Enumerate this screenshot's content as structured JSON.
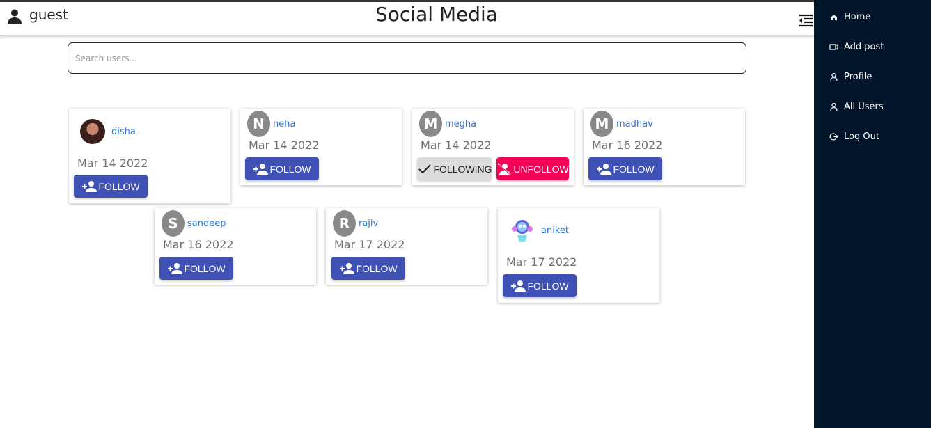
{
  "header": {
    "username": "guest",
    "title": "Social Media",
    "user_icon": "person-icon",
    "menu_icon": "menu-collapse-icon"
  },
  "search": {
    "placeholder": "Search users..."
  },
  "users": [
    {
      "name": "disha",
      "date": "Mar 14 2022",
      "avatar": "photo",
      "buttons": [
        "FOLLOW"
      ]
    },
    {
      "name": "neha",
      "date": "Mar 14 2022",
      "avatar_letter": "N",
      "buttons": [
        "FOLLOW"
      ]
    },
    {
      "name": "megha",
      "date": "Mar 14 2022",
      "avatar_letter": "M",
      "buttons": [
        "FOLLOWING",
        "UNFOLLOW"
      ]
    },
    {
      "name": "madhav",
      "date": "Mar 16 2022",
      "avatar_letter": "M",
      "buttons": [
        "FOLLOW"
      ]
    },
    {
      "name": "sandeep",
      "date": "Mar 16 2022",
      "avatar_letter": "S",
      "buttons": [
        "FOLLOW"
      ]
    },
    {
      "name": "rajiv",
      "date": "Mar 17 2022",
      "avatar_letter": "R",
      "buttons": [
        "FOLLOW"
      ]
    },
    {
      "name": "aniket",
      "date": "Mar 17 2022",
      "avatar": "robot-image",
      "buttons": [
        "FOLLOW"
      ]
    }
  ],
  "sidebar": {
    "items": [
      {
        "label": "Home",
        "icon": "home-icon"
      },
      {
        "label": "Add post",
        "icon": "video-icon"
      },
      {
        "label": "Profile",
        "icon": "user-icon"
      },
      {
        "label": "All Users",
        "icon": "user-icon"
      },
      {
        "label": "Log Out",
        "icon": "logout-icon"
      }
    ]
  },
  "colors": {
    "follow": "#3f51b5",
    "following": "#dcdcdc",
    "unfollow": "#f50057",
    "sidebar": "#001529",
    "link": "#2f74d0"
  }
}
